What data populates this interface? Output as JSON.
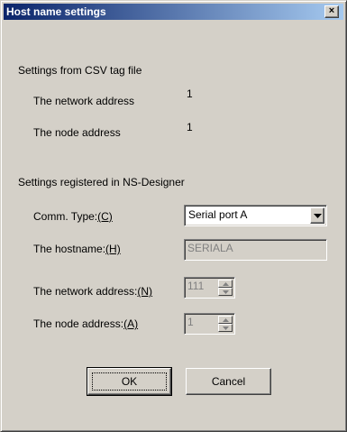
{
  "dialog": {
    "title": "Host name settings",
    "close_label": "×"
  },
  "csv_section": {
    "heading": "Settings from CSV tag file",
    "network_label": "The network address",
    "network_value": "1",
    "node_label": "The node address",
    "node_value": "1"
  },
  "designer_section": {
    "heading": "Settings registered in NS-Designer",
    "comm_type": {
      "label_text": "Comm. Type:",
      "accel": "(C)",
      "value": "Serial port A"
    },
    "hostname": {
      "label_text": "The hostname:",
      "accel": "(H)",
      "value": "SERIALA"
    },
    "network_address": {
      "label_text": "The network address:",
      "accel": "(N)",
      "value": "111"
    },
    "node_address": {
      "label_text": "The node address:",
      "accel": "(A)",
      "value": "1"
    }
  },
  "buttons": {
    "ok": "OK",
    "cancel": "Cancel"
  }
}
